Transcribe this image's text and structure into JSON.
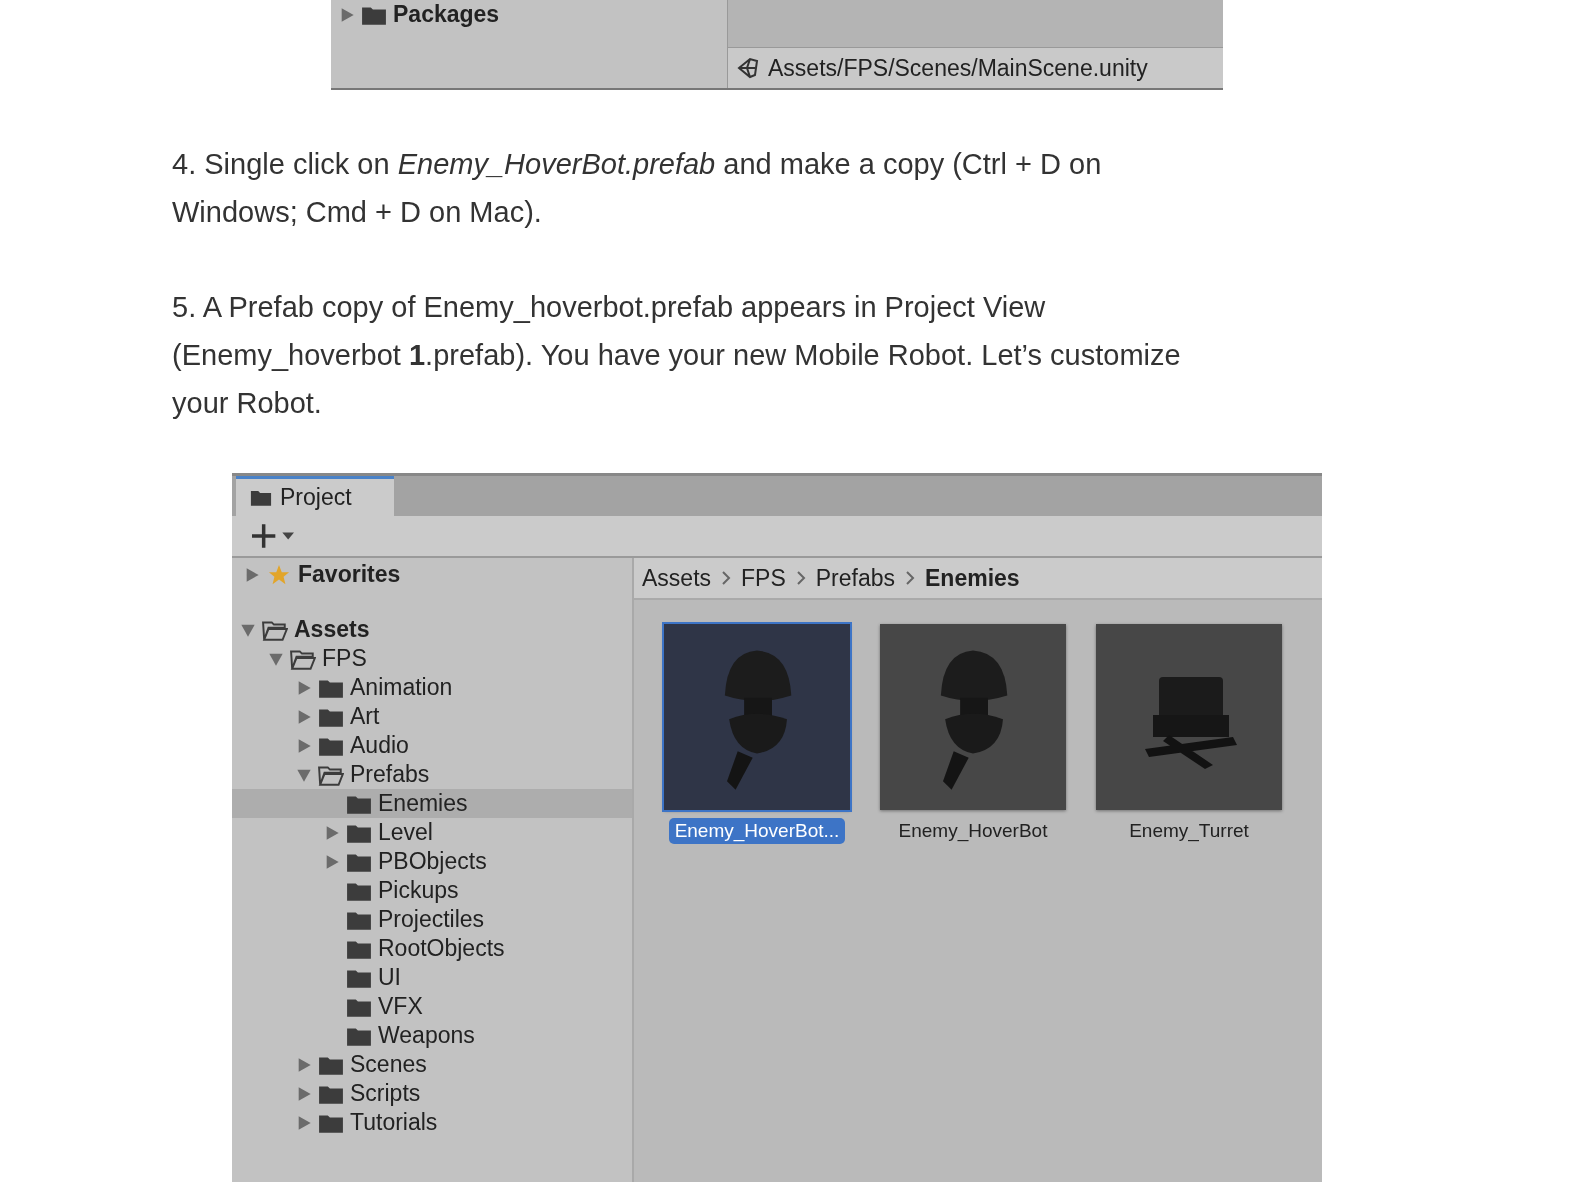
{
  "top_fragment": {
    "tree": [
      {
        "name": "Packages",
        "kind": "collapsed",
        "bold": true,
        "selected": false
      }
    ],
    "status_path": "Assets/FPS/Scenes/MainScene.unity"
  },
  "steps": [
    "4. Single click on *Enemy_HoverBot.prefab* and make a copy (Ctrl + D on Windows; Cmd + D on Mac).",
    "5. A Prefab copy of Enemy_hoverbot.prefab appears in Project View (Enemy_hoverbot **1**.prefab). You have your new Mobile Robot. Let’s customize your Robot."
  ],
  "project": {
    "tabs": [
      {
        "label": "Project",
        "selected": true
      }
    ],
    "favorites": {
      "name": "Favorites",
      "kind": "collapsed"
    },
    "tree": [
      {
        "name": "Assets",
        "kind": "expanded",
        "bold": true,
        "selected": false,
        "children": [
          {
            "name": "FPS",
            "kind": "expanded",
            "bold": false,
            "selected": false,
            "children": [
              {
                "name": "Animation",
                "kind": "collapsed",
                "bold": false,
                "selected": false
              },
              {
                "name": "Art",
                "kind": "collapsed",
                "bold": false,
                "selected": false
              },
              {
                "name": "Audio",
                "kind": "collapsed",
                "bold": false,
                "selected": false
              },
              {
                "name": "Prefabs",
                "kind": "expanded",
                "bold": false,
                "selected": false,
                "children": [
                  {
                    "name": "Enemies",
                    "kind": "folder",
                    "bold": false,
                    "selected": true
                  },
                  {
                    "name": "Level",
                    "kind": "collapsed",
                    "bold": false,
                    "selected": false
                  },
                  {
                    "name": "PBObjects",
                    "kind": "collapsed",
                    "bold": false,
                    "selected": false
                  },
                  {
                    "name": "Pickups",
                    "kind": "folder",
                    "bold": false,
                    "selected": false
                  },
                  {
                    "name": "Projectiles",
                    "kind": "folder",
                    "bold": false,
                    "selected": false
                  },
                  {
                    "name": "RootObjects",
                    "kind": "folder",
                    "bold": false,
                    "selected": false
                  },
                  {
                    "name": "UI",
                    "kind": "folder",
                    "bold": false,
                    "selected": false
                  },
                  {
                    "name": "VFX",
                    "kind": "folder",
                    "bold": false,
                    "selected": false
                  },
                  {
                    "name": "Weapons",
                    "kind": "folder",
                    "bold": false,
                    "selected": false
                  }
                ]
              },
              {
                "name": "Scenes",
                "kind": "collapsed",
                "bold": false,
                "selected": false
              },
              {
                "name": "Scripts",
                "kind": "collapsed",
                "bold": false,
                "selected": false
              },
              {
                "name": "Tutorials",
                "kind": "collapsed",
                "bold": false,
                "selected": false
              }
            ]
          }
        ]
      }
    ],
    "breadcrumb": [
      {
        "label": "Assets",
        "current": false
      },
      {
        "label": "FPS",
        "current": false
      },
      {
        "label": "Prefabs",
        "current": false
      },
      {
        "label": "Enemies",
        "current": true
      }
    ],
    "assets": [
      {
        "name": "Enemy_HoverBot...",
        "kind": "hoverbot",
        "selected": true
      },
      {
        "name": "Enemy_HoverBot",
        "kind": "hoverbot",
        "selected": false
      },
      {
        "name": "Enemy_Turret",
        "kind": "turret",
        "selected": false
      }
    ]
  }
}
